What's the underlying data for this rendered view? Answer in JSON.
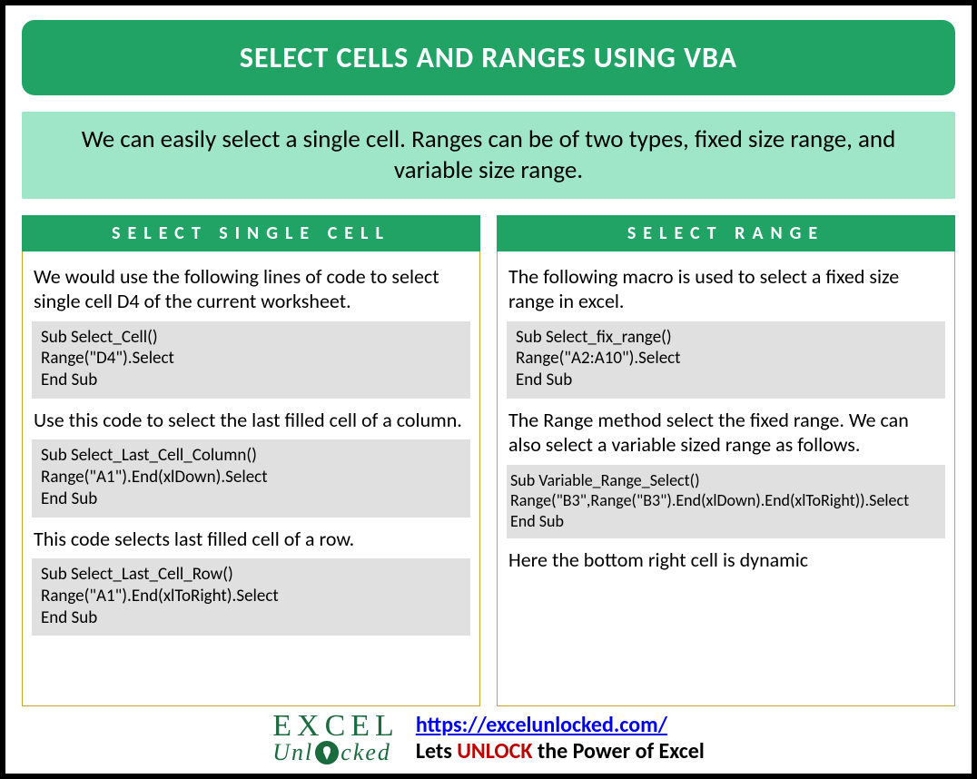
{
  "title": "SELECT CELLS AND RANGES USING VBA",
  "subtitle": "We can easily select a single cell. Ranges can be of two types, fixed size range, and variable size range.",
  "left": {
    "header": "SELECT SINGLE CELL",
    "p1": "We would use the following lines of code to select single cell D4 of the current worksheet.",
    "code1": "Sub Select_Cell()\nRange(\"D4\").Select\nEnd Sub",
    "p2": "Use this code to select the last filled cell of a column.",
    "code2": "Sub Select_Last_Cell_Column()\nRange(\"A1\").End(xlDown).Select\nEnd Sub",
    "p3": "This code selects last filled cell of a row.",
    "code3": "Sub Select_Last_Cell_Row()\nRange(\"A1\").End(xlToRight).Select\nEnd Sub"
  },
  "right": {
    "header": "SELECT RANGE",
    "p1": "The following macro is used to select a fixed size range in excel.",
    "code1": "Sub Select_fix_range()\nRange(\"A2:A10\").Select\nEnd Sub",
    "p2": "The Range method select the fixed range. We can also select a variable sized range as follows.",
    "code2": "Sub Variable_Range_Select()\nRange(\"B3\",Range(\"B3\").End(xlDown).End(xlToRight)).Select\nEnd Sub",
    "p3": "Here the bottom right cell is dynamic"
  },
  "footer": {
    "url": "https://excelunlocked.com/",
    "slogan_pre": "Lets ",
    "slogan_mid": "UNLOCK",
    "slogan_post": " the Power of Excel",
    "logo_l1": "EXCEL",
    "logo_l2a": "Unl",
    "logo_l2b": "cked"
  }
}
